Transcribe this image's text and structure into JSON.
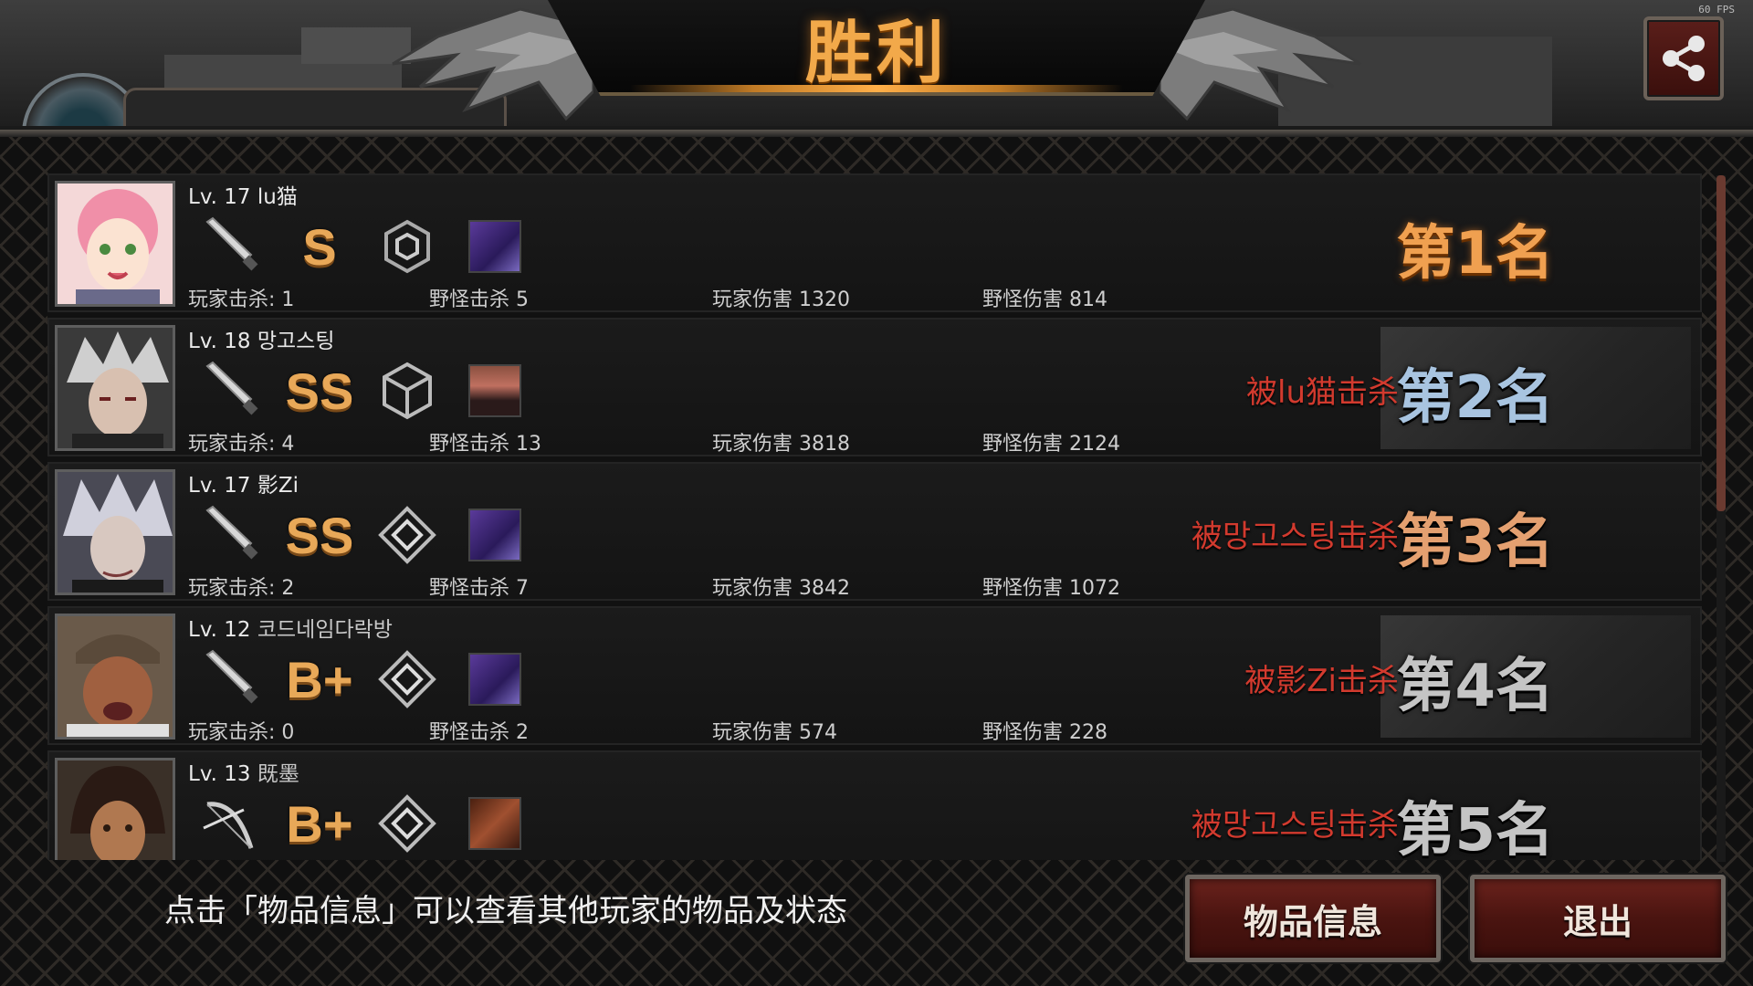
{
  "title": "胜利",
  "fps": "60 FPS",
  "hint": "点击「物品信息」可以查看其他玩家的物品及状态",
  "buttons": {
    "items": "物品信息",
    "exit": "退出"
  },
  "players": [
    {
      "level": "Lv. 17",
      "name": "lu猫",
      "weapon_icon": "knife-icon",
      "grade": "S",
      "grade_plus": "",
      "emblem_icon": "hexagon-emblem-icon",
      "skin_icon": "purple-skin-icon",
      "player_kills": "玩家击杀: 1",
      "monster_kills": "野怪击杀 5",
      "player_damage": "玩家伤害 1320",
      "monster_damage": "野怪伤害 814",
      "killed_by": "",
      "rank": "第1名"
    },
    {
      "level": "Lv. 18",
      "name": "망고스팅",
      "weapon_icon": "knife-icon",
      "grade": "SS",
      "grade_plus": "",
      "emblem_icon": "cube-emblem-icon",
      "skin_icon": "sunglasses-skin-icon",
      "player_kills": "玩家击杀: 4",
      "monster_kills": "野怪击杀 13",
      "player_damage": "玩家伤害 3818",
      "monster_damage": "野怪伤害 2124",
      "killed_by": "被lu猫击杀",
      "rank": "第2名"
    },
    {
      "level": "Lv. 17",
      "name": "影Zi",
      "weapon_icon": "knife-icon",
      "grade": "SS",
      "grade_plus": "",
      "emblem_icon": "diamond-emblem-icon",
      "skin_icon": "purple-skin-icon",
      "player_kills": "玩家击杀: 2",
      "monster_kills": "野怪击杀 7",
      "player_damage": "玩家伤害 3842",
      "monster_damage": "野怪伤害 1072",
      "killed_by": "被망고스팅击杀",
      "rank": "第3名"
    },
    {
      "level": "Lv. 12",
      "name": "코드네임다락방",
      "weapon_icon": "knife-icon",
      "grade": "B",
      "grade_plus": "+",
      "emblem_icon": "diamond-emblem-icon",
      "skin_icon": "purple-skin-icon",
      "player_kills": "玩家击杀: 0",
      "monster_kills": "野怪击杀 2",
      "player_damage": "玩家伤害 574",
      "monster_damage": "野怪伤害 228",
      "killed_by": "被影Zi击杀",
      "rank": "第4名"
    },
    {
      "level": "Lv. 13",
      "name": "既墨",
      "weapon_icon": "bow-icon",
      "grade": "B",
      "grade_plus": "+",
      "emblem_icon": "diamond-emblem-icon",
      "skin_icon": "crossed-skin-icon",
      "player_kills": "",
      "monster_kills": "",
      "player_damage": "",
      "monster_damage": "",
      "killed_by": "被망고스팅击杀",
      "rank": "第5名"
    }
  ],
  "colors": {
    "title": "#f2a94a",
    "killed_by": "#d23a2e",
    "button": "#4a1410",
    "grade": "#e8a858"
  }
}
